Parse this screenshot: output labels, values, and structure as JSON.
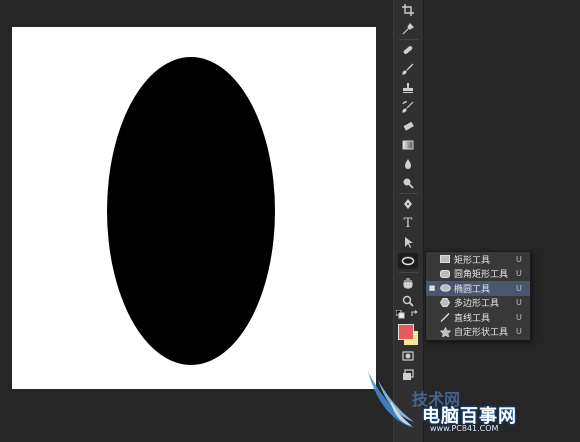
{
  "flyout": {
    "items": [
      {
        "label": "矩形工具",
        "shortcut": "U",
        "icon": "rectangle-icon",
        "selected": false
      },
      {
        "label": "圆角矩形工具",
        "shortcut": "U",
        "icon": "rounded-rectangle-icon",
        "selected": false
      },
      {
        "label": "椭圆工具",
        "shortcut": "U",
        "icon": "ellipse-icon",
        "selected": true
      },
      {
        "label": "多边形工具",
        "shortcut": "U",
        "icon": "polygon-icon",
        "selected": false
      },
      {
        "label": "直线工具",
        "shortcut": "U",
        "icon": "line-icon",
        "selected": false
      },
      {
        "label": "自定形状工具",
        "shortcut": "U",
        "icon": "custom-shape-icon",
        "selected": false
      }
    ]
  },
  "colors": {
    "foreground": "#e85a5a",
    "background": "#f2e6a0",
    "canvas": "#ffffff",
    "shape": "#000000",
    "workspace": "#262626"
  },
  "watermark": {
    "title": "电脑百事网",
    "url": "www.PC841.COM",
    "ghost": "技术网"
  }
}
